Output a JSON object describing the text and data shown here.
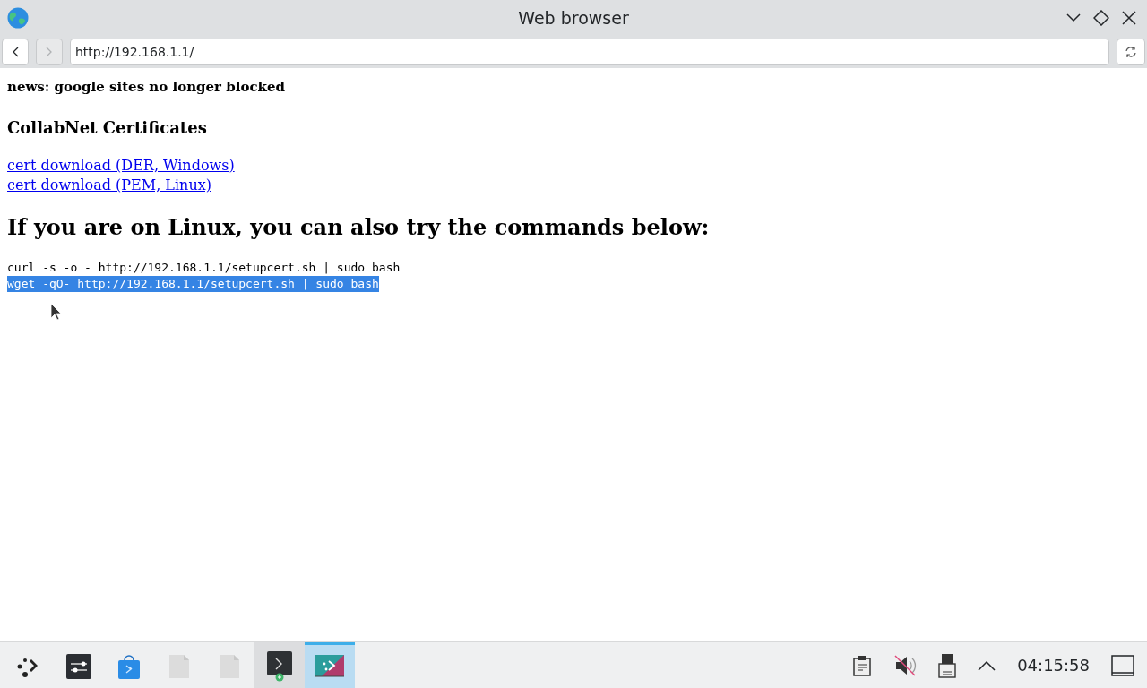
{
  "window": {
    "title": "Web browser"
  },
  "toolbar": {
    "back_disabled": false,
    "forward_disabled": true,
    "address": "http://192.168.1.1/"
  },
  "page": {
    "news": "news: google sites no longer blocked",
    "heading": "CollabNet Certificates",
    "links": [
      "cert download (DER, Windows)",
      "cert download (PEM, Linux)"
    ],
    "big_heading": "If you are on Linux, you can also try the commands below:",
    "commands": [
      {
        "text": "curl -s -o - http://192.168.1.1/setupcert.sh | sudo bash",
        "selected": false
      },
      {
        "text": "wget -qO- http://192.168.1.1/setupcert.sh | sudo bash",
        "selected": true
      }
    ]
  },
  "taskbar": {
    "items": [
      {
        "kind": "launcher",
        "selected": false,
        "hovered": false
      },
      {
        "kind": "settings",
        "selected": false,
        "hovered": false
      },
      {
        "kind": "store",
        "selected": false,
        "hovered": false
      },
      {
        "kind": "file",
        "selected": false,
        "hovered": false
      },
      {
        "kind": "file",
        "selected": false,
        "hovered": false
      },
      {
        "kind": "terminal",
        "selected": false,
        "hovered": true
      },
      {
        "kind": "browser",
        "selected": true,
        "hovered": false
      }
    ],
    "clock": "04:15:58"
  }
}
